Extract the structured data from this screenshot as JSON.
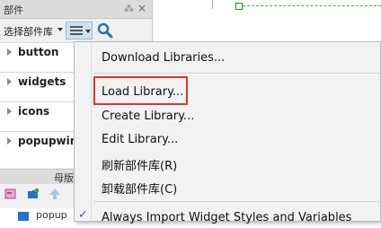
{
  "panel": {
    "title": "部件",
    "pin_glyph": "⁂",
    "close_glyph": "×",
    "selector_label": "选择部件库",
    "libraries": [
      {
        "label": "button"
      },
      {
        "label": "widgets"
      },
      {
        "label": "icons"
      },
      {
        "label": "popupwin"
      }
    ],
    "bottom_header": "母版",
    "bottom_item_label": "popup"
  },
  "menu": {
    "items": [
      {
        "label": "Download Libraries..."
      },
      {
        "label": "Load Library..."
      },
      {
        "label": "Create Library..."
      },
      {
        "label": "Edit Library..."
      },
      {
        "label": "刷新部件库(R)"
      },
      {
        "label": "卸载部件库(C)"
      },
      {
        "label": "Always Import Widget Styles and Variables",
        "checked": true
      }
    ],
    "check_glyph": "✓",
    "highlighted_item": "Load Library..."
  },
  "colors": {
    "highlight": "#e0342c",
    "accent": "#1e74c7",
    "guide": "#3cb43c"
  },
  "icons": [
    "pin-icon",
    "close-icon",
    "menu-icon",
    "search-icon",
    "expand-arrow-icon",
    "add-library-icon",
    "add-folder-icon",
    "up-arrow-icon",
    "check-icon"
  ]
}
